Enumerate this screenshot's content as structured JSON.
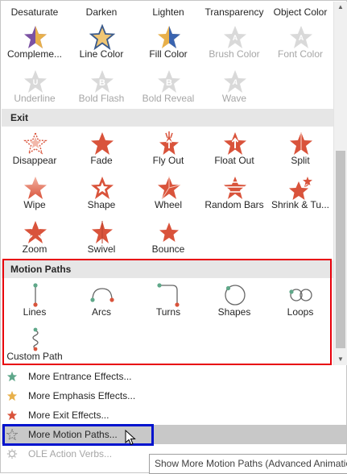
{
  "top_row": [
    "Desaturate",
    "Darken",
    "Lighten",
    "Transparency",
    "Object Color"
  ],
  "emphasis_row1": [
    {
      "label": "Compleme...",
      "icon": "star-purple-gold-icon",
      "disabled": false
    },
    {
      "label": "Line Color",
      "icon": "star-gold-outline-icon",
      "disabled": false
    },
    {
      "label": "Fill Color",
      "icon": "star-gold-blue-icon",
      "disabled": false
    },
    {
      "label": "Brush Color",
      "icon": "brush-color-a-icon",
      "disabled": true
    },
    {
      "label": "Font Color",
      "icon": "font-color-a-icon",
      "disabled": true
    }
  ],
  "emphasis_row2": [
    {
      "label": "Underline",
      "icon": "underline-u-icon",
      "disabled": true
    },
    {
      "label": "Bold Flash",
      "icon": "bold-flash-b-icon",
      "disabled": true
    },
    {
      "label": "Bold Reveal",
      "icon": "bold-reveal-b-icon",
      "disabled": true
    },
    {
      "label": "Wave",
      "icon": "wave-a-icon",
      "disabled": true
    }
  ],
  "exit_header": "Exit",
  "exit_row1": [
    {
      "label": "Disappear",
      "icon": "disappear-star-icon"
    },
    {
      "label": "Fade",
      "icon": "fade-star-icon"
    },
    {
      "label": "Fly Out",
      "icon": "fly-out-star-icon"
    },
    {
      "label": "Float Out",
      "icon": "float-out-star-icon"
    },
    {
      "label": "Split",
      "icon": "split-star-icon"
    }
  ],
  "exit_row2": [
    {
      "label": "Wipe",
      "icon": "wipe-star-icon"
    },
    {
      "label": "Shape",
      "icon": "shape-star-icon"
    },
    {
      "label": "Wheel",
      "icon": "wheel-star-icon"
    },
    {
      "label": "Random Bars",
      "icon": "random-bars-star-icon"
    },
    {
      "label": "Shrink & Tu...",
      "icon": "shrink-turn-star-icon"
    }
  ],
  "exit_row3": [
    {
      "label": "Zoom",
      "icon": "zoom-star-icon"
    },
    {
      "label": "Swivel",
      "icon": "swivel-star-icon"
    },
    {
      "label": "Bounce",
      "icon": "bounce-star-icon"
    }
  ],
  "motion_header": "Motion Paths",
  "motion_row1": [
    {
      "label": "Lines",
      "icon": "lines-path-icon"
    },
    {
      "label": "Arcs",
      "icon": "arcs-path-icon"
    },
    {
      "label": "Turns",
      "icon": "turns-path-icon"
    },
    {
      "label": "Shapes",
      "icon": "shapes-path-icon"
    },
    {
      "label": "Loops",
      "icon": "loops-path-icon"
    }
  ],
  "motion_row2": [
    {
      "label": "Custom Path",
      "icon": "custom-path-icon"
    }
  ],
  "menu": [
    {
      "label": "More Entrance Effects...",
      "icon": "green-star-icon",
      "disabled": false
    },
    {
      "label": "More Emphasis Effects...",
      "icon": "gold-star-icon",
      "disabled": false
    },
    {
      "label": "More Exit Effects...",
      "icon": "red-star-icon",
      "disabled": false
    },
    {
      "label": "More Motion Paths...",
      "icon": "outline-star-icon",
      "disabled": false
    },
    {
      "label": "OLE Action Verbs...",
      "icon": "ole-gear-icon",
      "disabled": true
    }
  ],
  "tooltip": "Show More Motion Paths (Advanced Animation",
  "colors": {
    "exit_red": "#d9533b",
    "emphasis_gold": "#e8b04a",
    "entrance_green": "#5ea78a",
    "highlight_red": "#e8000b",
    "highlight_blue": "#0013ce",
    "path_green": "#5fa889",
    "path_red": "#d9533b"
  }
}
